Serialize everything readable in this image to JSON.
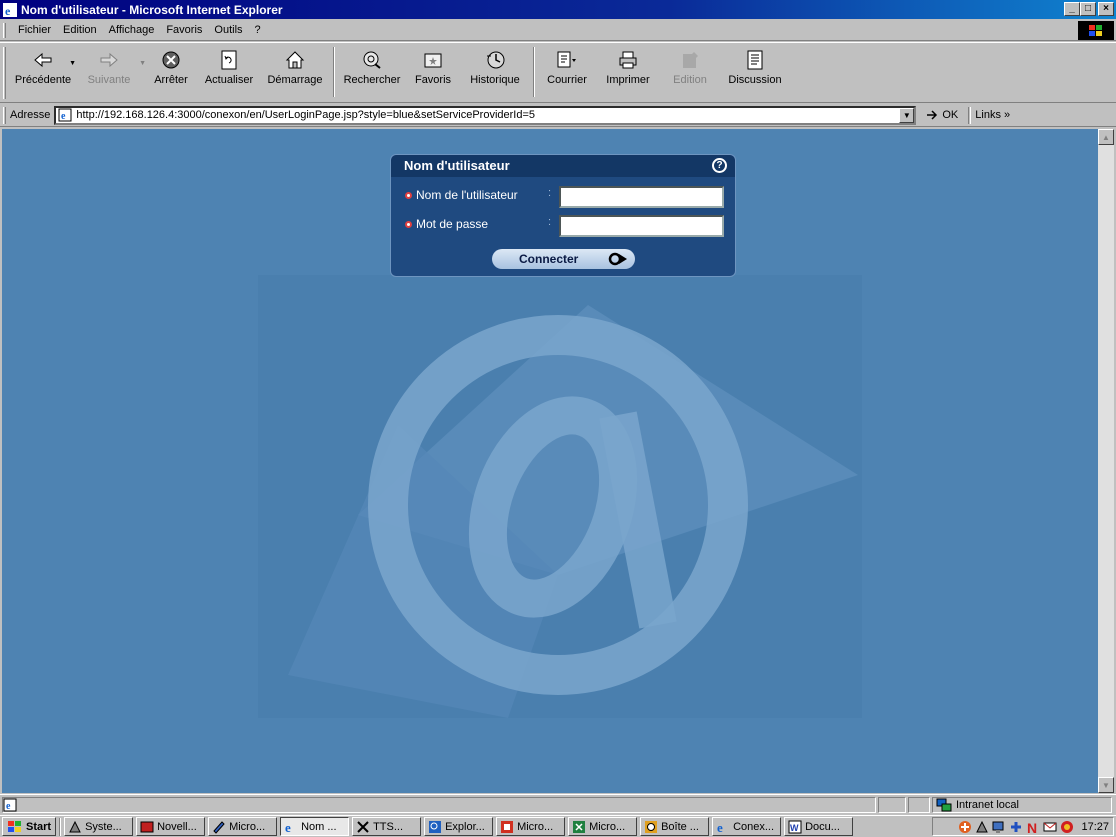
{
  "window": {
    "title": "Nom d'utilisateur - Microsoft Internet Explorer",
    "controls": [
      "_",
      "□",
      "×"
    ]
  },
  "menu": {
    "items": [
      "Fichier",
      "Edition",
      "Affichage",
      "Favoris",
      "Outils",
      "?"
    ]
  },
  "toolbar": {
    "buttons": [
      {
        "label": "Précédente",
        "icon": "back-arrow-icon"
      },
      {
        "label": "Suivante",
        "icon": "forward-arrow-icon"
      },
      {
        "label": "Arrêter",
        "icon": "stop-icon"
      },
      {
        "label": "Actualiser",
        "icon": "refresh-icon"
      },
      {
        "label": "Démarrage",
        "icon": "home-icon"
      },
      {
        "label": "Rechercher",
        "icon": "search-icon"
      },
      {
        "label": "Favoris",
        "icon": "favorites-icon"
      },
      {
        "label": "Historique",
        "icon": "history-icon"
      },
      {
        "label": "Courrier",
        "icon": "mail-icon"
      },
      {
        "label": "Imprimer",
        "icon": "print-icon"
      },
      {
        "label": "Edition",
        "icon": "edit-icon"
      },
      {
        "label": "Discussion",
        "icon": "discussion-icon"
      }
    ]
  },
  "address": {
    "label": "Adresse",
    "url": "http://192.168.126.4:3000/conexon/en/UserLoginPage.jsp?style=blue&setServiceProviderId=5",
    "go_label": "OK",
    "links_label": "Links »"
  },
  "login": {
    "title": "Nom d'utilisateur",
    "help": "?",
    "username_label": "Nom de l'utilisateur",
    "password_label": "Mot de passe",
    "separator": ":",
    "username_value": "",
    "password_value": "",
    "connect_label": "Connecter"
  },
  "status": {
    "zone": "Intranet local"
  },
  "taskbar": {
    "start_label": "Start",
    "tasks": [
      {
        "label": "Syste..."
      },
      {
        "label": "Novell..."
      },
      {
        "label": "Micro..."
      },
      {
        "label": "Nom ..."
      },
      {
        "label": "TTS..."
      },
      {
        "label": "Explor..."
      },
      {
        "label": "Micro..."
      },
      {
        "label": "Micro..."
      },
      {
        "label": "Boîte ..."
      },
      {
        "label": "Conex..."
      },
      {
        "label": "Docu..."
      }
    ],
    "clock": "17:27"
  },
  "colors": {
    "title_bar": "#000080",
    "content_bg": "#4e83b2",
    "panel_bg": "#1f4a80",
    "panel_header": "#133765",
    "required_dot": "#e04040"
  }
}
